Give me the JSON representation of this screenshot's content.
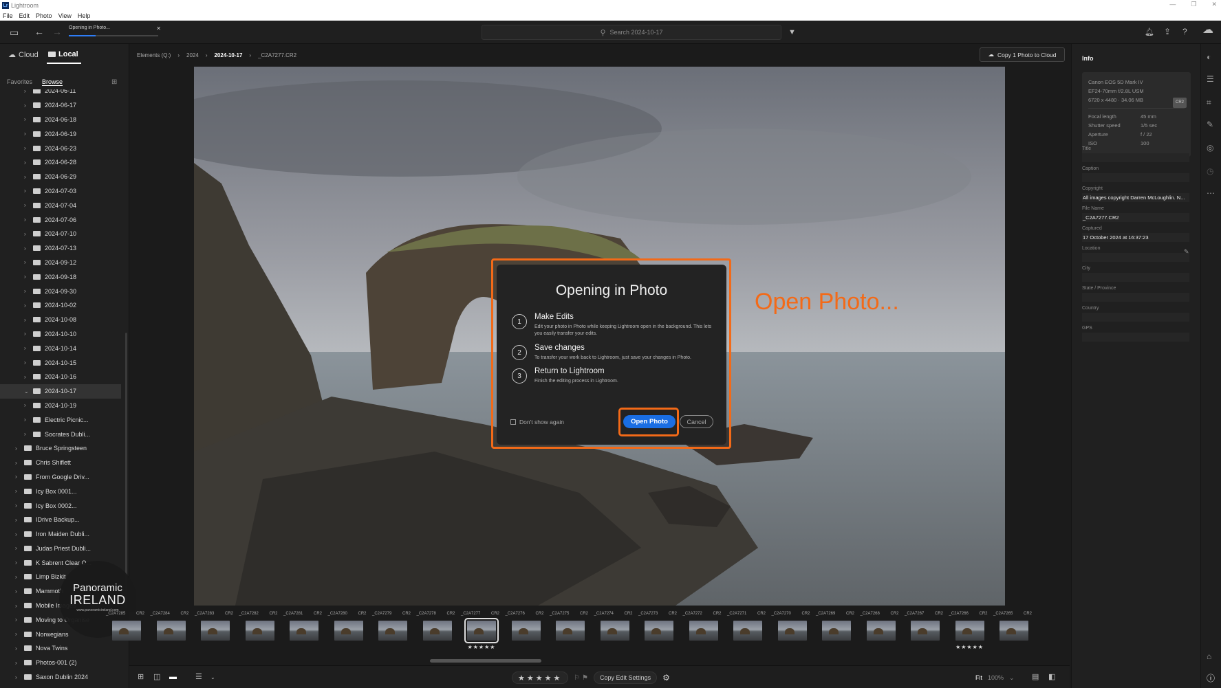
{
  "window": {
    "title": "Lightroom",
    "app_icon": "Lr",
    "controls": [
      "—",
      "❐",
      "✕"
    ]
  },
  "menu": [
    "File",
    "Edit",
    "Photo",
    "View",
    "Help"
  ],
  "toolbar": {
    "progress_label": "Opening in Photo...",
    "progress_fraction": 0.3,
    "search_placeholder": "Search 2024-10-17"
  },
  "sidebar": {
    "cloud_label": "Cloud",
    "local_label": "Local",
    "favorites_label": "Favorites",
    "browse_label": "Browse",
    "tree": [
      {
        "label": "2024-06-11",
        "depth": 1
      },
      {
        "label": "2024-06-17",
        "depth": 1
      },
      {
        "label": "2024-06-18",
        "depth": 1
      },
      {
        "label": "2024-06-19",
        "depth": 1
      },
      {
        "label": "2024-06-23",
        "depth": 1
      },
      {
        "label": "2024-06-28",
        "depth": 1
      },
      {
        "label": "2024-06-29",
        "depth": 1
      },
      {
        "label": "2024-07-03",
        "depth": 1
      },
      {
        "label": "2024-07-04",
        "depth": 1
      },
      {
        "label": "2024-07-06",
        "depth": 1
      },
      {
        "label": "2024-07-10",
        "depth": 1
      },
      {
        "label": "2024-07-13",
        "depth": 1
      },
      {
        "label": "2024-09-12",
        "depth": 1
      },
      {
        "label": "2024-09-18",
        "depth": 1
      },
      {
        "label": "2024-09-30",
        "depth": 1
      },
      {
        "label": "2024-10-02",
        "depth": 1
      },
      {
        "label": "2024-10-08",
        "depth": 1
      },
      {
        "label": "2024-10-10",
        "depth": 1
      },
      {
        "label": "2024-10-14",
        "depth": 1
      },
      {
        "label": "2024-10-15",
        "depth": 1
      },
      {
        "label": "2024-10-16",
        "depth": 1
      },
      {
        "label": "2024-10-17",
        "depth": 1,
        "selected": true,
        "expanded": true
      },
      {
        "label": "2024-10-19",
        "depth": 1
      },
      {
        "label": "Electric Picnic...",
        "depth": 1
      },
      {
        "label": "Socrates Dubli...",
        "depth": 1
      },
      {
        "label": "Bruce Springsteen",
        "depth": 0
      },
      {
        "label": "Chris Shiflett",
        "depth": 0
      },
      {
        "label": "From Google Driv...",
        "depth": 0
      },
      {
        "label": "Icy Box 0001...",
        "depth": 0
      },
      {
        "label": "Icy Box 0002...",
        "depth": 0
      },
      {
        "label": "IDrive Backup...",
        "depth": 0
      },
      {
        "label": "Iron Maiden Dubli...",
        "depth": 0
      },
      {
        "label": "Judas Priest Dubli...",
        "depth": 0
      },
      {
        "label": "K Sabrent Clear O...",
        "depth": 0
      },
      {
        "label": "Limp Bizkit",
        "depth": 0
      },
      {
        "label": "Mammoth",
        "depth": 0
      },
      {
        "label": "Mobile Images",
        "depth": 0
      },
      {
        "label": "Moving to Organise",
        "depth": 0
      },
      {
        "label": "Norwegians",
        "depth": 0
      },
      {
        "label": "Nova Twins",
        "depth": 0
      },
      {
        "label": "Photos-001 (2)",
        "depth": 0
      },
      {
        "label": "Saxon Dublin 2024",
        "depth": 0
      }
    ]
  },
  "watermark": {
    "line1": "Panoramic",
    "line2": "IRELAND",
    "line3": "www.panoramicireland.com"
  },
  "breadcrumb": [
    "Elements (Q:)",
    "2024",
    "2024-10-17",
    "_C2A7277.CR2"
  ],
  "copy_cloud_label": "Copy 1 Photo to Cloud",
  "dialog": {
    "title": "Opening in Photo",
    "steps": [
      {
        "num": "1",
        "title": "Make Edits",
        "desc": "Edit your photo in Photo while keeping Lightroom open in the background. This lets you easily transfer your edits."
      },
      {
        "num": "2",
        "title": "Save changes",
        "desc": "To transfer your work back to Lightroom, just save your changes in Photo."
      },
      {
        "num": "3",
        "title": "Return to Lightroom",
        "desc": "Finish the editing process in Lightroom."
      }
    ],
    "dont_show": "Don't show again",
    "open_label": "Open Photo",
    "cancel_label": "Cancel"
  },
  "annotation": "Open Photo...",
  "filmstrip": [
    {
      "name": "_C2A7285",
      "ext": "CR2"
    },
    {
      "name": "_C2A7284",
      "ext": "CR2"
    },
    {
      "name": "_C2A7283",
      "ext": "CR2"
    },
    {
      "name": "_C2A7282",
      "ext": "CR2"
    },
    {
      "name": "_C2A7281",
      "ext": "CR2"
    },
    {
      "name": "_C2A7280",
      "ext": "CR2"
    },
    {
      "name": "_C2A7279",
      "ext": "CR2"
    },
    {
      "name": "_C2A7278",
      "ext": "CR2"
    },
    {
      "name": "_C2A7277",
      "ext": "CR2",
      "selected": true,
      "stars": "★★★★★"
    },
    {
      "name": "_C2A7276",
      "ext": "CR2"
    },
    {
      "name": "_C2A7275",
      "ext": "CR2"
    },
    {
      "name": "_C2A7274",
      "ext": "CR2"
    },
    {
      "name": "_C2A7273",
      "ext": "CR2"
    },
    {
      "name": "_C2A7272",
      "ext": "CR2"
    },
    {
      "name": "_C2A7271",
      "ext": "CR2"
    },
    {
      "name": "_C2A7270",
      "ext": "CR2"
    },
    {
      "name": "_C2A7269",
      "ext": "CR2"
    },
    {
      "name": "_C2A7268",
      "ext": "CR2"
    },
    {
      "name": "_C2A7267",
      "ext": "CR2"
    },
    {
      "name": "_C2A7266",
      "ext": "CR2",
      "stars": "★★★★★"
    },
    {
      "name": "_C2A7265",
      "ext": "CR2"
    }
  ],
  "bottom": {
    "rating": "★★★★★",
    "copy_edit": "Copy Edit Settings",
    "fit": "Fit",
    "zoom": "100%"
  },
  "info": {
    "title": "Info",
    "camera": "Canon EOS 5D Mark IV",
    "lens": "EF24-70mm f/2.8L USM",
    "dims": "6720 x 4480  ·  34.06 MB",
    "format_badge": "CR2",
    "exif": [
      {
        "k": "Focal length",
        "v": "45 mm"
      },
      {
        "k": "Shutter speed",
        "v": "1/5 sec"
      },
      {
        "k": "Aperture",
        "v": "f / 22"
      },
      {
        "k": "ISO",
        "v": "100"
      }
    ],
    "fields": [
      {
        "label": "Title",
        "value": ""
      },
      {
        "label": "Caption",
        "value": ""
      },
      {
        "label": "Copyright",
        "value": "All images copyright Darren McLoughlin. N..."
      },
      {
        "label": "File Name",
        "value": "_C2A7277.CR2"
      },
      {
        "label": "Captured",
        "value": "17 October 2024 at 16:37:23"
      },
      {
        "label": "Location",
        "value": ""
      },
      {
        "label": "City",
        "value": ""
      },
      {
        "label": "State / Province",
        "value": ""
      },
      {
        "label": "Country",
        "value": ""
      },
      {
        "label": "GPS",
        "value": ""
      }
    ]
  },
  "colors": {
    "accent": "#1a6ee3",
    "annotation": "#f36a18"
  }
}
